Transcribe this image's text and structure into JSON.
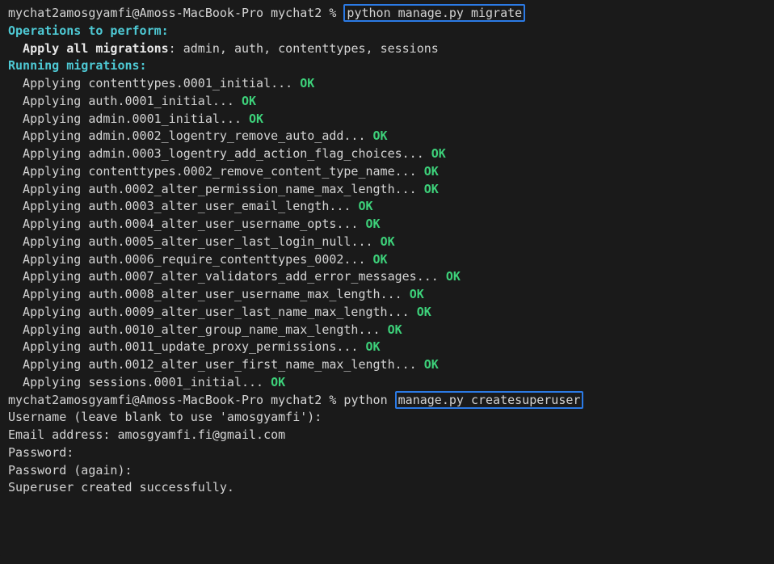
{
  "prompt1": {
    "prefix": "mychat2amosgyamfi@Amoss-MacBook-Pro mychat2 % ",
    "cmd": "python manage.py migrate"
  },
  "section1_header": "Operations to perform:",
  "apply_label": "Apply all migrations",
  "apply_list": ": admin, auth, contenttypes, sessions",
  "section2_header": "Running migrations:",
  "migrations": [
    "contenttypes.0001_initial",
    "auth.0001_initial",
    "admin.0001_initial",
    "admin.0002_logentry_remove_auto_add",
    "admin.0003_logentry_add_action_flag_choices",
    "contenttypes.0002_remove_content_type_name",
    "auth.0002_alter_permission_name_max_length",
    "auth.0003_alter_user_email_length",
    "auth.0004_alter_user_username_opts",
    "auth.0005_alter_user_last_login_null",
    "auth.0006_require_contenttypes_0002",
    "auth.0007_alter_validators_add_error_messages",
    "auth.0008_alter_user_username_max_length",
    "auth.0009_alter_user_last_name_max_length",
    "auth.0010_alter_group_name_max_length",
    "auth.0011_update_proxy_permissions",
    "auth.0012_alter_user_first_name_max_length",
    "sessions.0001_initial"
  ],
  "applying_prefix": "Applying ",
  "applying_suffix": "... ",
  "ok_label": "OK",
  "prompt2": {
    "prefix": "mychat2amosgyamfi@Amoss-MacBook-Pro mychat2 % python ",
    "cmd": "manage.py createsuperuser"
  },
  "superuser": {
    "username_prompt": "Username (leave blank to use 'amosgyamfi'):",
    "email_label": "Email address: ",
    "email_value": "amosgyamfi.fi@gmail.com",
    "password1": "Password:",
    "password2": "Password (again):",
    "success": "Superuser created successfully."
  }
}
